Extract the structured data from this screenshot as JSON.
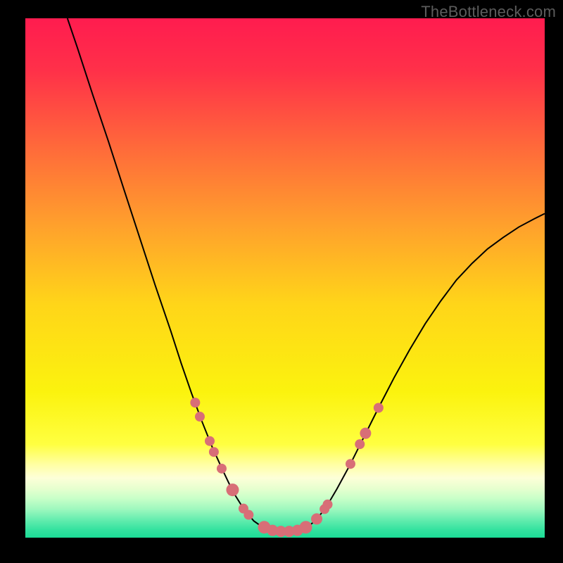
{
  "watermark": "TheBottleneck.com",
  "chart_data": {
    "type": "line",
    "title": "",
    "xlabel": "",
    "ylabel": "",
    "ylim": [
      0,
      100
    ],
    "curve_points": [
      {
        "x": 0.081,
        "y": 1.0
      },
      {
        "x": 0.1,
        "y": 0.944
      },
      {
        "x": 0.13,
        "y": 0.852
      },
      {
        "x": 0.16,
        "y": 0.763
      },
      {
        "x": 0.19,
        "y": 0.67
      },
      {
        "x": 0.22,
        "y": 0.578
      },
      {
        "x": 0.25,
        "y": 0.486
      },
      {
        "x": 0.28,
        "y": 0.398
      },
      {
        "x": 0.3,
        "y": 0.336
      },
      {
        "x": 0.32,
        "y": 0.278
      },
      {
        "x": 0.34,
        "y": 0.224
      },
      {
        "x": 0.36,
        "y": 0.174
      },
      {
        "x": 0.38,
        "y": 0.13
      },
      {
        "x": 0.4,
        "y": 0.088
      },
      {
        "x": 0.42,
        "y": 0.056
      },
      {
        "x": 0.44,
        "y": 0.032
      },
      {
        "x": 0.46,
        "y": 0.018
      },
      {
        "x": 0.48,
        "y": 0.012
      },
      {
        "x": 0.5,
        "y": 0.012
      },
      {
        "x": 0.52,
        "y": 0.012
      },
      {
        "x": 0.54,
        "y": 0.018
      },
      {
        "x": 0.56,
        "y": 0.034
      },
      {
        "x": 0.58,
        "y": 0.06
      },
      {
        "x": 0.6,
        "y": 0.094
      },
      {
        "x": 0.625,
        "y": 0.14
      },
      {
        "x": 0.65,
        "y": 0.19
      },
      {
        "x": 0.68,
        "y": 0.25
      },
      {
        "x": 0.71,
        "y": 0.308
      },
      {
        "x": 0.74,
        "y": 0.362
      },
      {
        "x": 0.77,
        "y": 0.412
      },
      {
        "x": 0.8,
        "y": 0.456
      },
      {
        "x": 0.83,
        "y": 0.496
      },
      {
        "x": 0.86,
        "y": 0.528
      },
      {
        "x": 0.89,
        "y": 0.556
      },
      {
        "x": 0.92,
        "y": 0.578
      },
      {
        "x": 0.95,
        "y": 0.598
      },
      {
        "x": 0.98,
        "y": 0.614
      },
      {
        "x": 1.0,
        "y": 0.624
      }
    ],
    "points": [
      {
        "x": 0.327,
        "y": 0.26,
        "r": 7
      },
      {
        "x": 0.336,
        "y": 0.233,
        "r": 7
      },
      {
        "x": 0.355,
        "y": 0.186,
        "r": 7
      },
      {
        "x": 0.363,
        "y": 0.165,
        "r": 7
      },
      {
        "x": 0.378,
        "y": 0.133,
        "r": 7
      },
      {
        "x": 0.399,
        "y": 0.092,
        "r": 9
      },
      {
        "x": 0.42,
        "y": 0.056,
        "r": 7
      },
      {
        "x": 0.43,
        "y": 0.044,
        "r": 7
      },
      {
        "x": 0.46,
        "y": 0.02,
        "r": 9
      },
      {
        "x": 0.476,
        "y": 0.014,
        "r": 8
      },
      {
        "x": 0.492,
        "y": 0.012,
        "r": 8
      },
      {
        "x": 0.508,
        "y": 0.012,
        "r": 8
      },
      {
        "x": 0.524,
        "y": 0.014,
        "r": 8
      },
      {
        "x": 0.54,
        "y": 0.02,
        "r": 9
      },
      {
        "x": 0.561,
        "y": 0.036,
        "r": 8
      },
      {
        "x": 0.576,
        "y": 0.055,
        "r": 7
      },
      {
        "x": 0.582,
        "y": 0.064,
        "r": 7
      },
      {
        "x": 0.626,
        "y": 0.142,
        "r": 7
      },
      {
        "x": 0.644,
        "y": 0.18,
        "r": 7
      },
      {
        "x": 0.655,
        "y": 0.201,
        "r": 8
      },
      {
        "x": 0.68,
        "y": 0.25,
        "r": 7
      }
    ],
    "gradient_stops": [
      {
        "pos": 0.0,
        "color": "#ff1c4f"
      },
      {
        "pos": 0.1,
        "color": "#ff3049"
      },
      {
        "pos": 0.25,
        "color": "#ff6a3a"
      },
      {
        "pos": 0.4,
        "color": "#ffa12c"
      },
      {
        "pos": 0.55,
        "color": "#ffd519"
      },
      {
        "pos": 0.72,
        "color": "#fbf30e"
      },
      {
        "pos": 0.82,
        "color": "#ffff40"
      },
      {
        "pos": 0.86,
        "color": "#ffffa5"
      },
      {
        "pos": 0.885,
        "color": "#fdffd8"
      },
      {
        "pos": 0.905,
        "color": "#e7ffcf"
      },
      {
        "pos": 0.925,
        "color": "#c7ffc8"
      },
      {
        "pos": 0.945,
        "color": "#9ef8be"
      },
      {
        "pos": 0.965,
        "color": "#66edaf"
      },
      {
        "pos": 0.985,
        "color": "#33e29f"
      },
      {
        "pos": 1.0,
        "color": "#1cdc96"
      }
    ]
  }
}
